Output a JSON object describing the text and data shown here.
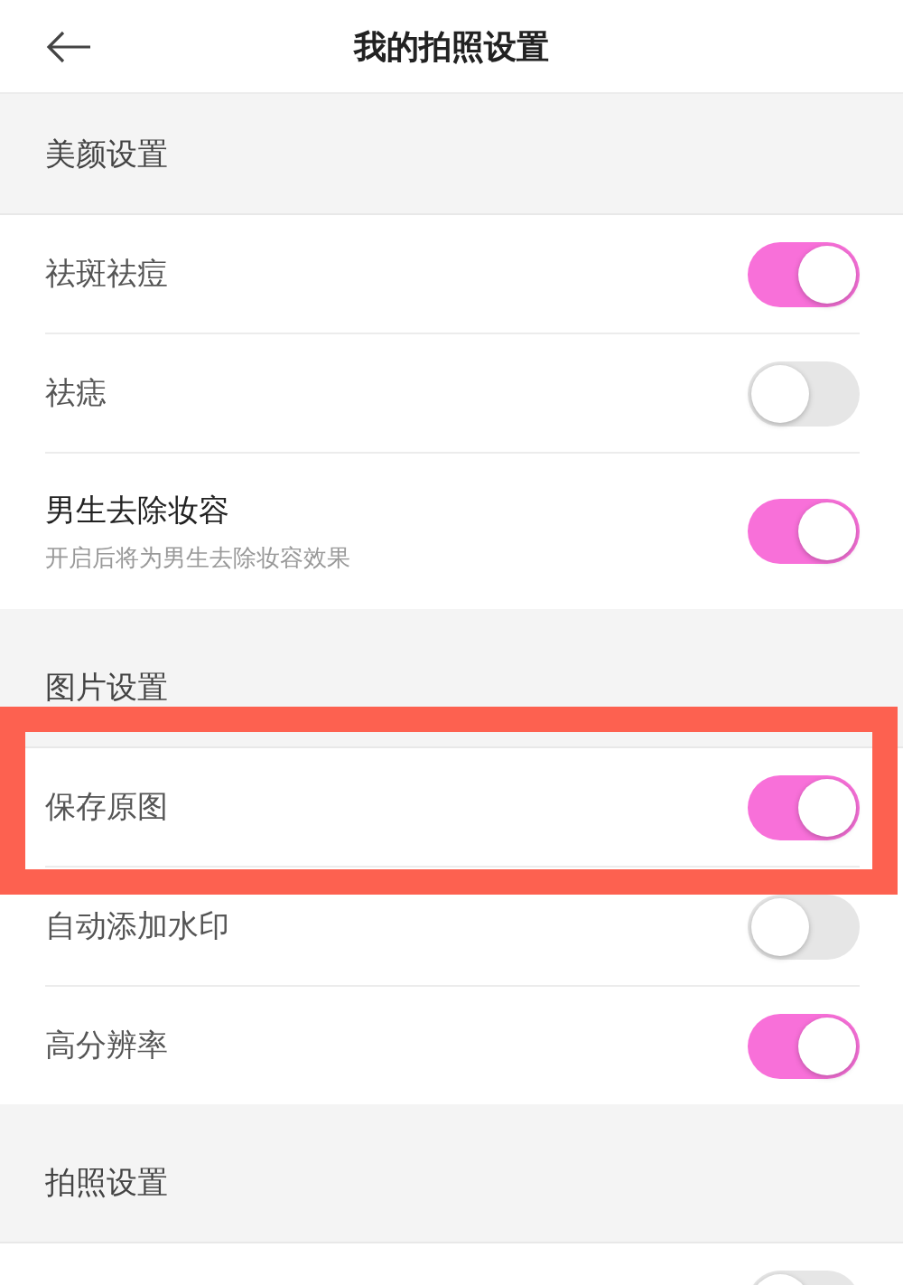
{
  "header": {
    "title": "我的拍照设置"
  },
  "sections": [
    {
      "title": "美颜设置",
      "items": [
        {
          "label": "祛斑祛痘",
          "on": true,
          "highlighted": false
        },
        {
          "label": "祛痣",
          "on": false,
          "highlighted": false
        },
        {
          "label": "男生去除妆容",
          "subtitle": "开启后将为男生去除妆容效果",
          "on": true,
          "highlighted": false
        }
      ]
    },
    {
      "title": "图片设置",
      "items": [
        {
          "label": "保存原图",
          "on": true,
          "highlighted": true
        },
        {
          "label": "自动添加水印",
          "on": false,
          "highlighted": false
        },
        {
          "label": "高分辨率",
          "on": true,
          "highlighted": false
        }
      ]
    },
    {
      "title": "拍照设置",
      "items": [
        {
          "on": false
        }
      ]
    }
  ]
}
